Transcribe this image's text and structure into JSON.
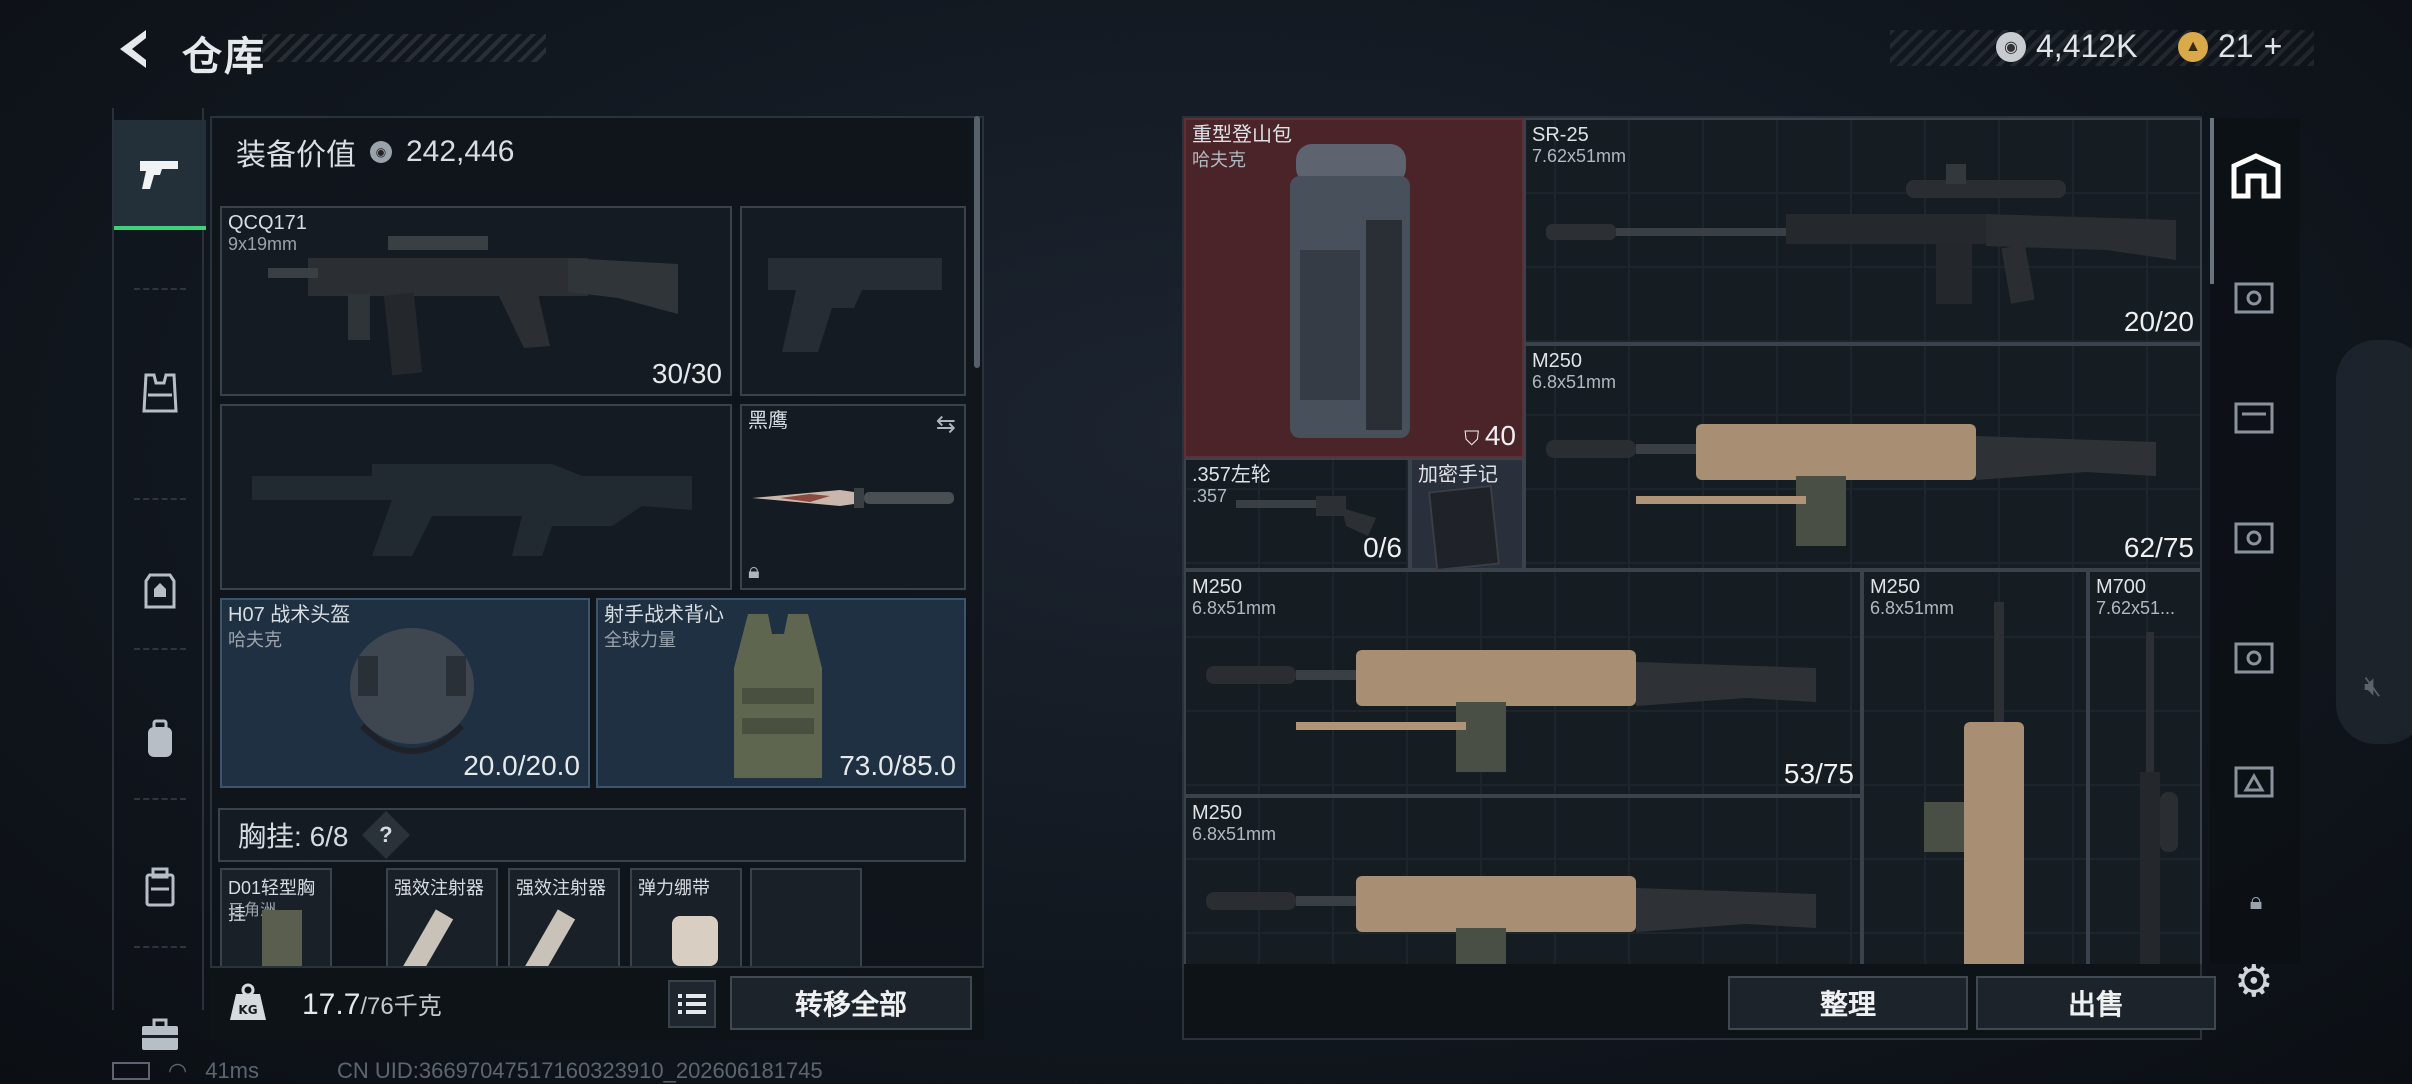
{
  "header": {
    "title": "仓库"
  },
  "currency": {
    "money": "4,412K",
    "tickets": "21",
    "tickets_plus": "+"
  },
  "left_rail": {
    "icons": [
      "pistol-icon",
      "vest-icon",
      "armor-plate-icon",
      "backpack-icon",
      "case-icon",
      "toolbox-icon"
    ]
  },
  "equipment": {
    "value_label": "装备价值",
    "value": "242,446",
    "primary": {
      "name": "QCQ171",
      "caliber": "9x19mm",
      "count": "30/30"
    },
    "knife": {
      "name": "黑鹰"
    },
    "helmet": {
      "name": "H07 战术头盔",
      "brand": "哈夫克",
      "durability": "20.0/20.0"
    },
    "vest": {
      "name": "射手战术背心",
      "brand": "全球力量",
      "durability": "73.0/85.0"
    },
    "chest_rig": {
      "label": "胸挂:",
      "value": "6/8",
      "help": "?"
    },
    "rig_items": [
      {
        "name": "D01轻型胸挂",
        "sub": "三角洲"
      },
      {
        "name": "强效注射器",
        "sub": ""
      },
      {
        "name": "强效注射器",
        "sub": ""
      },
      {
        "name": "弹力绷带",
        "sub": ""
      }
    ]
  },
  "capacity": {
    "current": "17.7",
    "max": "/76千克"
  },
  "actions": {
    "transfer_all": "转移全部",
    "sort": "整理",
    "sell": "出售"
  },
  "stash": {
    "items": [
      {
        "name": "重型登山包",
        "sub": "哈夫克",
        "count": "40"
      },
      {
        "name": "SR-25",
        "sub": "7.62x51mm",
        "count": "20/20"
      },
      {
        "name": "M250",
        "sub": "6.8x51mm",
        "count": "62/75"
      },
      {
        "name": ".357左轮",
        "sub": ".357",
        "count": "0/6"
      },
      {
        "name": "加密手记",
        "sub": "",
        "count": ""
      },
      {
        "name": "M250",
        "sub": "6.8x51mm",
        "count": "53/75"
      },
      {
        "name": "M250",
        "sub": "6.8x51mm",
        "count": ""
      },
      {
        "name": "M700",
        "sub": "7.62x51...",
        "count": ""
      },
      {
        "name": "M250",
        "sub": "6.8x51mm",
        "count": ""
      }
    ]
  },
  "status_bar": {
    "ping": "41ms",
    "uid": "CN UID:36697047517160323910_202606181745"
  }
}
